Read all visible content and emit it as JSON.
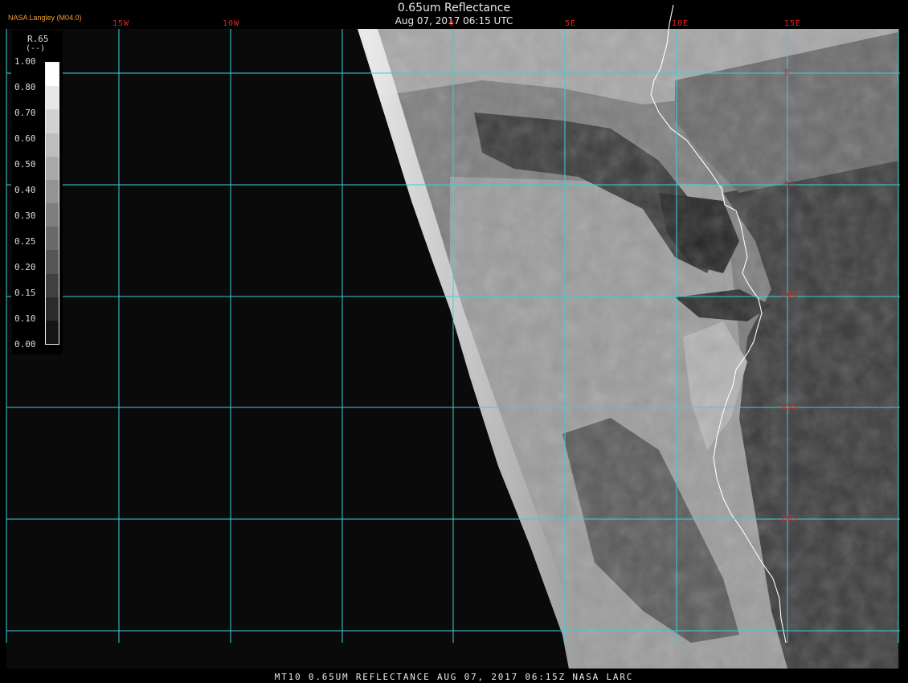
{
  "header": {
    "title": "0.65um Reflectance",
    "datetime": "Aug 07, 2017 06:15 UTC",
    "credit": "NASA Langley (M04.0)"
  },
  "footer": {
    "caption": "MT10  0.65UM REFLECTANCE  AUG 07, 2017 06:15Z  NASA LARC"
  },
  "map": {
    "lon_labels": [
      "15W",
      "10W",
      "0",
      "5E",
      "10E",
      "15E"
    ],
    "lat_labels": [
      "0",
      "5S",
      "10S",
      "15S",
      "20S"
    ],
    "gridline_color": "#3ad0d8",
    "coastline_color": "#ffffff",
    "label_color": "#dd2222"
  },
  "legend": {
    "channel": "R.65",
    "units": "(--)",
    "ticks": [
      "1.00",
      "0.80",
      "0.70",
      "0.60",
      "0.50",
      "0.40",
      "0.30",
      "0.25",
      "0.20",
      "0.15",
      "0.10",
      "0.00"
    ],
    "grays": [
      "#ffffff",
      "#e8e8e8",
      "#d2d2d2",
      "#bdbdbd",
      "#a8a8a8",
      "#939393",
      "#7e7e7e",
      "#6a6a6a",
      "#555555",
      "#404040",
      "#2b2b2b",
      "#151515"
    ]
  }
}
